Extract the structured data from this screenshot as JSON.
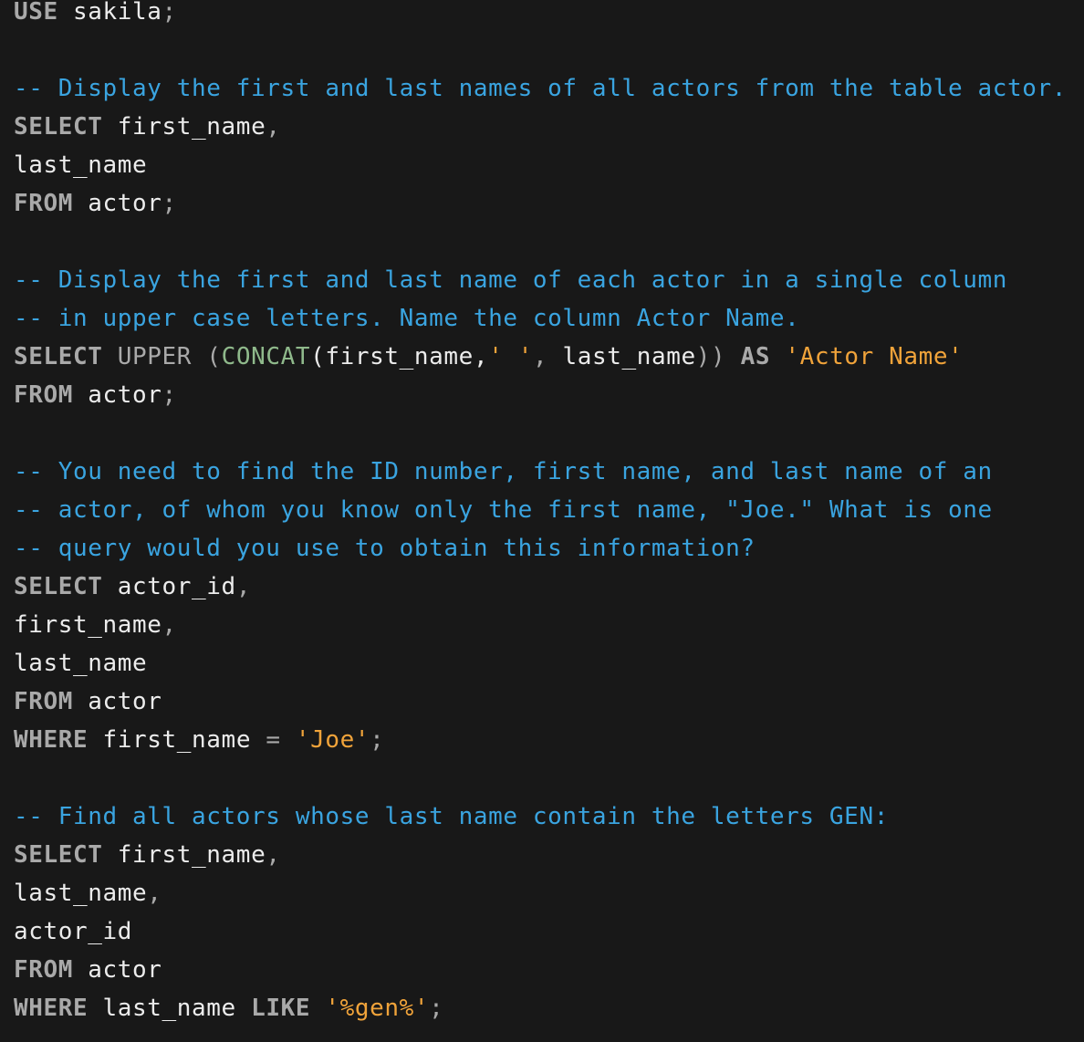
{
  "colors": {
    "background": "#181818",
    "text": "#ececec",
    "keyword": "#a9a9a9",
    "comment": "#3aa4e0",
    "string": "#f0a33a",
    "function_concat": "#8fb98b"
  },
  "lines": {
    "l1": {
      "kw": "USE",
      "rest": " sakila",
      "semi": ";"
    },
    "l3": "-- Display the first and last names of all actors from the table actor.",
    "l4": {
      "kw": "SELECT",
      "rest": " first_name",
      "comma": ","
    },
    "l5": "last_name",
    "l6": {
      "kw": "FROM",
      "rest": " actor",
      "semi": ";"
    },
    "l8": "-- Display the first and last name of each actor in a single column",
    "l9": "-- in upper case letters. Name the column Actor Name.",
    "l10": {
      "kw": "SELECT",
      "sp1": " ",
      "upper": "UPPER",
      "sp2": " ",
      "paren_open": "(",
      "concat": "CONCAT",
      "args_open": "(",
      "arg1": "first_name",
      "comma1": ",",
      "str1": "' '",
      "comma2": ",",
      "arg2": " last_name",
      "paren_close": "))",
      "sp3": " ",
      "as": "AS",
      "sp4": " ",
      "alias": "'Actor Name'"
    },
    "l11": {
      "kw": "FROM",
      "rest": " actor",
      "semi": ";"
    },
    "l13": "-- You need to find the ID number, first name, and last name of an",
    "l14": "-- actor, of whom you know only the first name, \"Joe.\" What is one",
    "l15": "-- query would you use to obtain this information?",
    "l16": {
      "kw": "SELECT",
      "rest": " actor_id",
      "comma": ","
    },
    "l17": {
      "rest": "first_name",
      "comma": ","
    },
    "l18": "last_name",
    "l19": {
      "kw": "FROM",
      "rest": " actor"
    },
    "l20": {
      "kw": "WHERE",
      "rest": " first_name ",
      "op": "=",
      "sp": " ",
      "str": "'Joe'",
      "semi": ";"
    },
    "l22": "-- Find all actors whose last name contain the letters GEN:",
    "l23": {
      "kw": "SELECT",
      "rest": " first_name",
      "comma": ","
    },
    "l24": {
      "rest": "last_name",
      "comma": ","
    },
    "l25": "actor_id",
    "l26": {
      "kw": "FROM",
      "rest": " actor"
    },
    "l27": {
      "kw": "WHERE",
      "rest": " last_name ",
      "like": "LIKE",
      "sp": " ",
      "str": "'%gen%'",
      "semi": ";"
    }
  }
}
